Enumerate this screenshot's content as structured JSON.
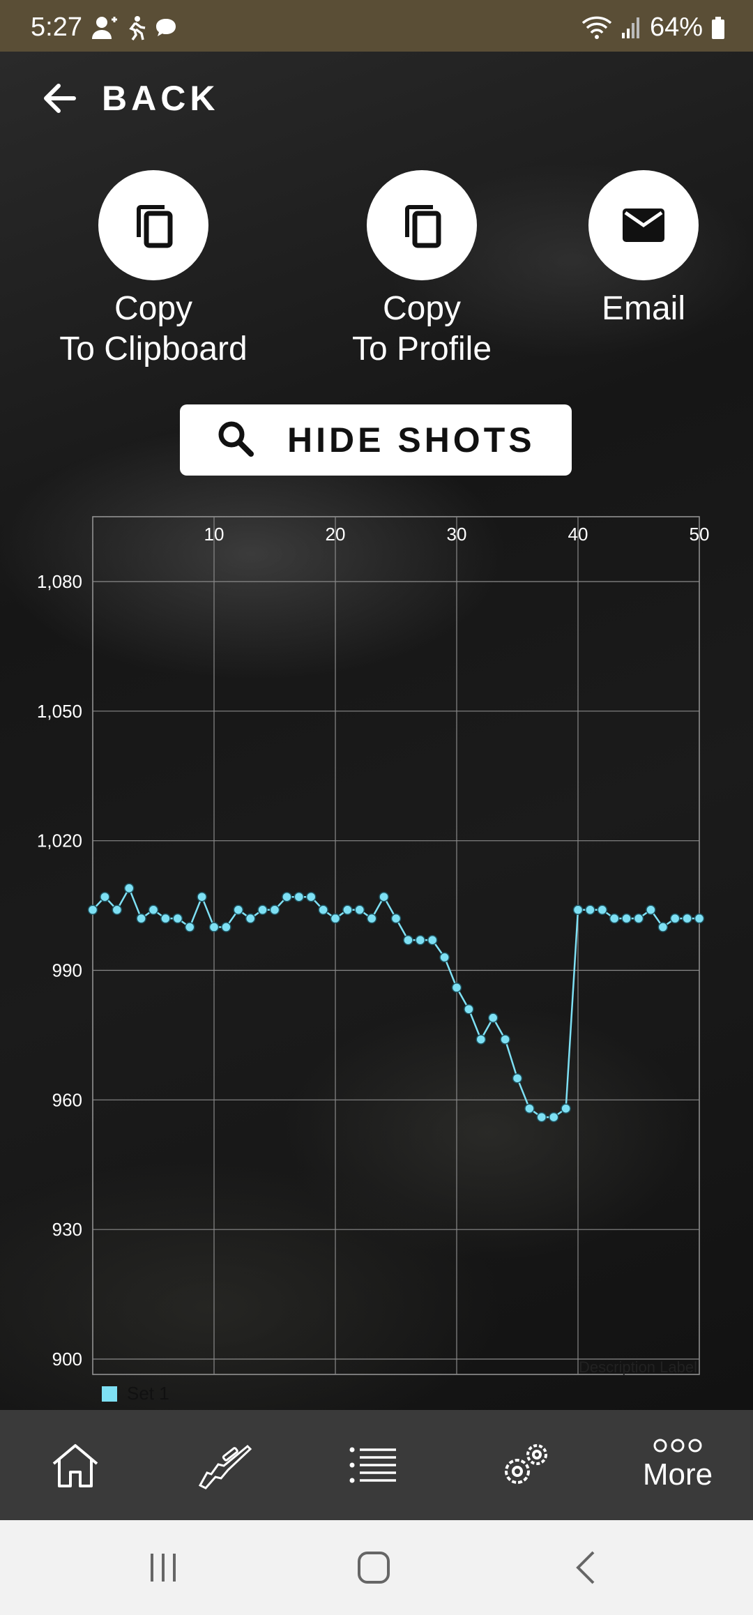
{
  "status_bar": {
    "time": "5:27",
    "battery": "64%"
  },
  "back": {
    "label": "BACK"
  },
  "actions": [
    {
      "label": "Copy\nTo Clipboard",
      "icon": "copy-icon"
    },
    {
      "label": "Copy\nTo Profile",
      "icon": "copy-icon"
    },
    {
      "label": "Email",
      "icon": "email-icon"
    }
  ],
  "hide_shots": {
    "label": "HIDE SHOTS",
    "icon": "search-icon"
  },
  "chart_data": {
    "type": "line",
    "x_ticks": [
      10,
      20,
      30,
      40,
      50
    ],
    "y_ticks": [
      "1,080",
      "1,050",
      "1,020",
      "990",
      "960",
      "930",
      "900"
    ],
    "xlim": [
      0,
      50
    ],
    "ylim": [
      900,
      1085
    ],
    "grid": true,
    "legend_position": "bottom-left",
    "series": [
      {
        "name": "Set 1",
        "color": "#7ee0f4",
        "x": [
          0,
          1,
          2,
          3,
          4,
          5,
          6,
          7,
          8,
          9,
          10,
          11,
          12,
          13,
          14,
          15,
          16,
          17,
          18,
          19,
          20,
          21,
          22,
          23,
          24,
          25,
          26,
          27,
          28,
          29,
          30,
          31,
          32,
          33,
          34,
          35,
          36,
          37,
          38,
          39,
          40,
          41,
          42,
          43,
          44,
          45,
          46,
          47,
          48,
          49,
          50
        ],
        "values": [
          1004,
          1007,
          1004,
          1009,
          1002,
          1004,
          1002,
          1002,
          1000,
          1007,
          1000,
          1000,
          1004,
          1002,
          1004,
          1004,
          1007,
          1007,
          1007,
          1004,
          1002,
          1004,
          1004,
          1002,
          1007,
          1002,
          997,
          997,
          997,
          993,
          986,
          981,
          974,
          979,
          974,
          965,
          958,
          956,
          956,
          958,
          1004,
          1004,
          1004,
          1002,
          1002,
          1002,
          1004,
          1000,
          1002,
          1002,
          1002
        ]
      }
    ],
    "description_label": "Description Label"
  },
  "bottom_nav": [
    {
      "icon": "home-icon"
    },
    {
      "icon": "rifle-icon"
    },
    {
      "icon": "list-icon"
    },
    {
      "icon": "settings-icon"
    },
    {
      "icon": "more-icon",
      "label": "More"
    }
  ]
}
